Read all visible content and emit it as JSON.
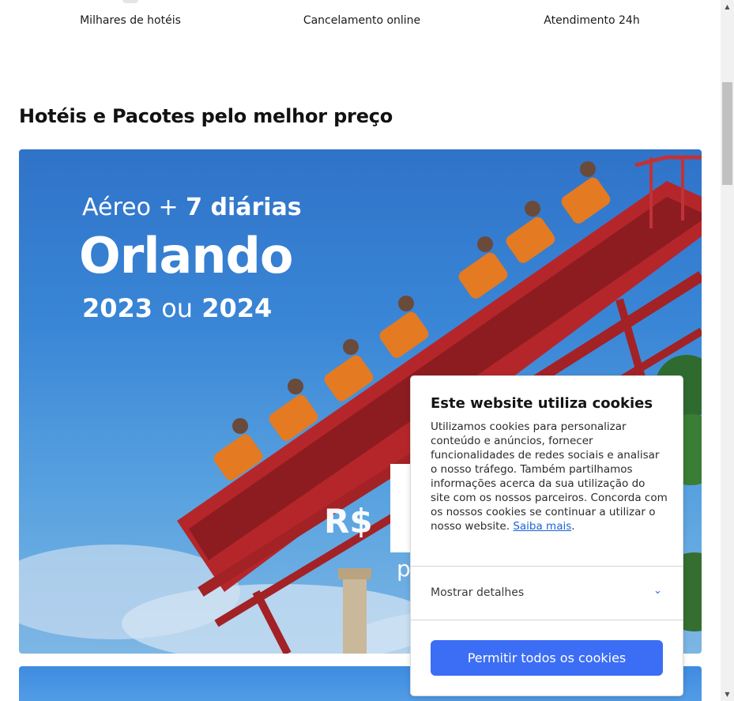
{
  "features": [
    {
      "label": "Milhares de hotéis"
    },
    {
      "label": "Cancelamento online"
    },
    {
      "label": "Atendimento 24h"
    }
  ],
  "section": {
    "title": "Hotéis e Pacotes pelo melhor preço"
  },
  "banner": {
    "line1_prefix": "Aéreo + ",
    "line1_bold": "7 diárias",
    "destination": "Orlando",
    "years_a": "2023 ",
    "years_or": "ou",
    "years_b": " 2024",
    "currency": "R$",
    "suffix": "p"
  },
  "cookie_banner": {
    "title": "Este website utiliza cookies",
    "body": "Utilizamos cookies para personalizar conteúdo e anúncios, fornecer funcionalidades de redes sociais e analisar o nosso tráfego. Também partilhamos informações acerca da sua utilização do site com os nossos parceiros. Concorda com os nossos cookies se continuar a utilizar o nosso website.",
    "link": "Saiba mais",
    "period": ".",
    "details_label": "Mostrar detalhes",
    "accept_label": "Permitir todos os cookies"
  },
  "colors": {
    "accent": "#3c6df5",
    "link": "#1a63d8",
    "coaster_track": "#b5262b",
    "seat": "#e47a22"
  },
  "icons": {
    "chevron": "chevron-down-icon",
    "scroll_up": "scroll-up-arrow-icon",
    "scroll_down": "scroll-down-arrow-icon"
  }
}
